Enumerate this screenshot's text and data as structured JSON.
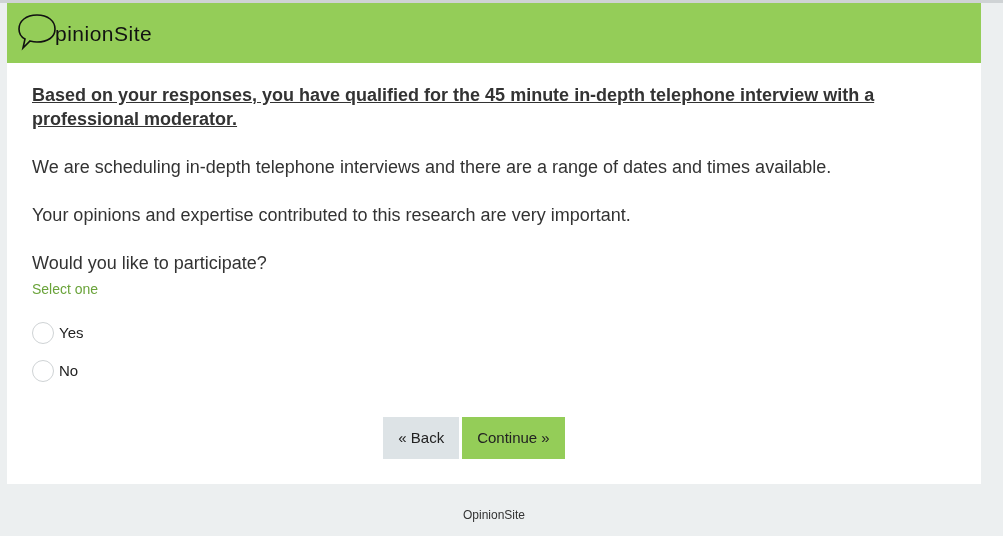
{
  "header": {
    "logo_text": "pinionSite"
  },
  "headline": "Based on your responses, you have qualified for the 45 minute in-depth telephone interview with a professional moderator.",
  "paragraphs": [
    "We are scheduling in-depth telephone interviews and there are a range of dates and times available.",
    "Your opinions and expertise contributed to this research are very important."
  ],
  "question": {
    "text": "Would you like to participate?",
    "hint": "Select one",
    "options": [
      {
        "label": "Yes",
        "selected": false
      },
      {
        "label": "No",
        "selected": false
      }
    ]
  },
  "buttons": [
    {
      "kind": "back",
      "label": "« Back"
    },
    {
      "kind": "next",
      "label": "Continue »"
    }
  ],
  "footer": "OpinionSite"
}
